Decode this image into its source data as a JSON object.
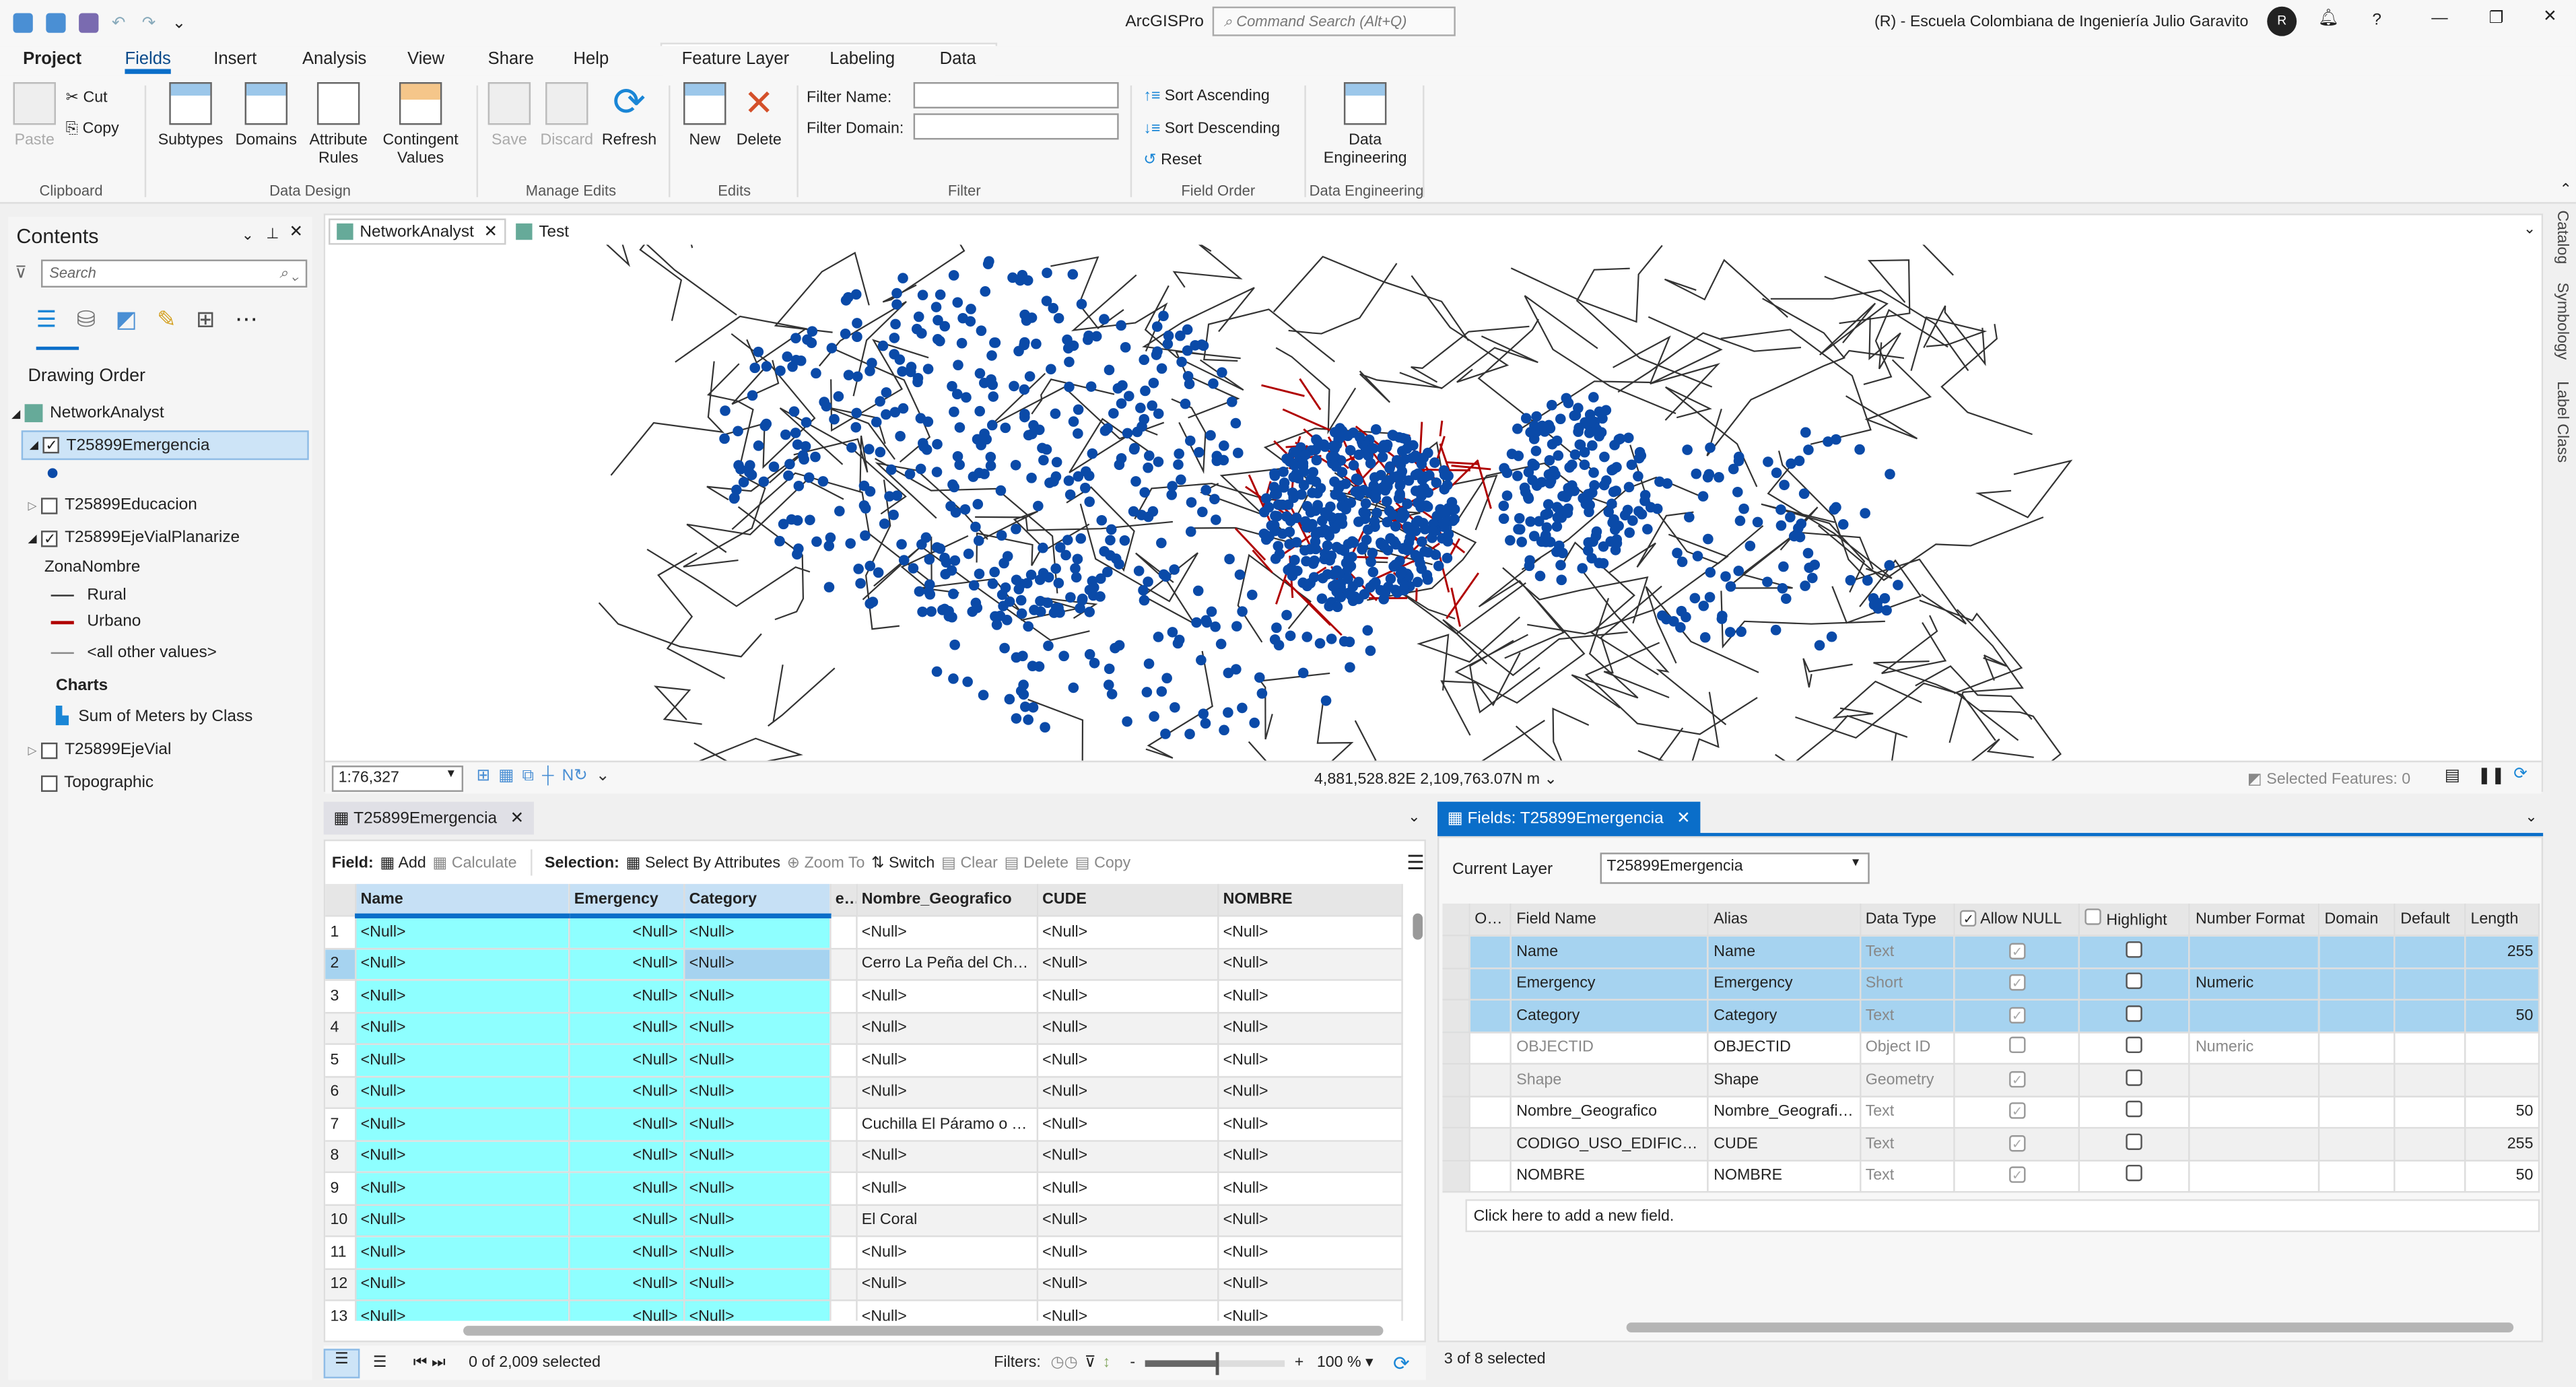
{
  "app": {
    "title": "ArcGISPro",
    "search_placeholder": "Command Search (Alt+Q)",
    "account": "(R) - Escuela Colombiana de Ingeniería Julio Garavito",
    "avatar": "R"
  },
  "tabs": [
    "Project",
    "Fields",
    "Insert",
    "Analysis",
    "View",
    "Share",
    "Help"
  ],
  "context_tabs": [
    "Feature Layer",
    "Labeling",
    "Data"
  ],
  "ribbon": {
    "clipboard": {
      "paste": "Paste",
      "cut": "Cut",
      "copy": "Copy",
      "group": "Clipboard"
    },
    "data_design": {
      "subtypes": "Subtypes",
      "domains": "Domains",
      "attribute_rules": "Attribute Rules",
      "contingent_values": "Contingent Values",
      "group": "Data Design"
    },
    "manage_edits": {
      "save": "Save",
      "discard": "Discard",
      "refresh": "Refresh",
      "group": "Manage Edits"
    },
    "edits": {
      "new": "New",
      "delete": "Delete",
      "group": "Edits"
    },
    "filter": {
      "name_label": "Filter Name:",
      "domain_label": "Filter Domain:",
      "name_value": "",
      "domain_value": "",
      "group": "Filter"
    },
    "field_order": {
      "asc": "Sort Ascending",
      "desc": "Sort Descending",
      "reset": "Reset",
      "group": "Field Order"
    },
    "data_engineering": {
      "button": "Data Engineering",
      "group": "Data Engineering"
    }
  },
  "contents": {
    "title": "Contents",
    "search_placeholder": "Search",
    "drawing_order": "Drawing Order",
    "items": {
      "map": "NetworkAnalyst",
      "l1": "T25899Emergencia",
      "l2": "T25899Educacion",
      "l3": "T25899EjeVialPlanarize",
      "field": "ZonaNombre",
      "rural": "Rural",
      "urbano": "Urbano",
      "other": "<all other values>",
      "charts": "Charts",
      "chart1": "Sum of Meters by Class",
      "l4": "T25899EjeVial",
      "l5": "Topographic"
    }
  },
  "map_tabs": [
    "NetworkAnalyst",
    "Test"
  ],
  "map_status": {
    "scale": "1:76,327",
    "coords": "4,881,528.82E 2,109,763.07N m",
    "selected": "Selected Features: 0"
  },
  "right_strip": [
    "Catalog",
    "Symbology",
    "Label Class"
  ],
  "attr_table": {
    "tab": "T25899Emergencia",
    "field_label": "Field:",
    "add": "Add",
    "calculate": "Calculate",
    "selection_label": "Selection:",
    "select_by_attr": "Select By Attributes",
    "zoom_to": "Zoom To",
    "switch": "Switch",
    "clear": "Clear",
    "delete": "Delete",
    "copy": "Copy",
    "columns": [
      "Name",
      "Emergency",
      "Category",
      "e *",
      "Nombre_Geografico",
      "CUDE",
      "NOMBRE"
    ],
    "rows": [
      [
        "1",
        "<Null>",
        "<Null>",
        "<Null>",
        "",
        "<Null>",
        "<Null>",
        "<Null>"
      ],
      [
        "2",
        "<Null>",
        "<Null>",
        "<Null>",
        "",
        "Cerro La Peña del Chulo",
        "<Null>",
        "<Null>"
      ],
      [
        "3",
        "<Null>",
        "<Null>",
        "<Null>",
        "",
        "<Null>",
        "<Null>",
        "<Null>"
      ],
      [
        "4",
        "<Null>",
        "<Null>",
        "<Null>",
        "",
        "<Null>",
        "<Null>",
        "<Null>"
      ],
      [
        "5",
        "<Null>",
        "<Null>",
        "<Null>",
        "",
        "<Null>",
        "<Null>",
        "<Null>"
      ],
      [
        "6",
        "<Null>",
        "<Null>",
        "<Null>",
        "",
        "<Null>",
        "<Null>",
        "<Null>"
      ],
      [
        "7",
        "<Null>",
        "<Null>",
        "<Null>",
        "",
        "Cuchilla El Páramo o Tor...",
        "<Null>",
        "<Null>"
      ],
      [
        "8",
        "<Null>",
        "<Null>",
        "<Null>",
        "",
        "<Null>",
        "<Null>",
        "<Null>"
      ],
      [
        "9",
        "<Null>",
        "<Null>",
        "<Null>",
        "",
        "<Null>",
        "<Null>",
        "<Null>"
      ],
      [
        "10",
        "<Null>",
        "<Null>",
        "<Null>",
        "",
        "El Coral",
        "<Null>",
        "<Null>"
      ],
      [
        "11",
        "<Null>",
        "<Null>",
        "<Null>",
        "",
        "<Null>",
        "<Null>",
        "<Null>"
      ],
      [
        "12",
        "<Null>",
        "<Null>",
        "<Null>",
        "",
        "<Null>",
        "<Null>",
        "<Null>"
      ],
      [
        "13",
        "<Null>",
        "<Null>",
        "<Null>",
        "",
        "<Null>",
        "<Null>",
        "<Null>"
      ]
    ],
    "selected_count": "0 of 2,009 selected",
    "filters": "Filters:",
    "zoom": "100 %"
  },
  "fields_view": {
    "tab": "Fields: T25899Emergencia",
    "current_layer_label": "Current Layer",
    "current_layer": "T25899Emergencia",
    "columns": [
      "Only",
      "Field Name",
      "Alias",
      "Data Type",
      "Allow NULL",
      "Highlight",
      "Number Format",
      "Domain",
      "Default",
      "Length"
    ],
    "rows": [
      {
        "name": "Name",
        "alias": "Name",
        "type": "Text",
        "allow_null": true,
        "highlight": false,
        "format": "",
        "length": "255",
        "selected": true
      },
      {
        "name": "Emergency",
        "alias": "Emergency",
        "type": "Short",
        "allow_null": true,
        "highlight": false,
        "format": "Numeric",
        "length": "",
        "selected": true
      },
      {
        "name": "Category",
        "alias": "Category",
        "type": "Text",
        "allow_null": true,
        "highlight": false,
        "format": "",
        "length": "50",
        "selected": true
      },
      {
        "name": "OBJECTID",
        "alias": "OBJECTID",
        "type": "Object ID",
        "allow_null": false,
        "highlight": false,
        "format": "Numeric",
        "length": "",
        "selected": false
      },
      {
        "name": "Shape",
        "alias": "Shape",
        "type": "Geometry",
        "allow_null": true,
        "highlight": false,
        "format": "",
        "length": "",
        "selected": false
      },
      {
        "name": "Nombre_Geografico",
        "alias": "Nombre_Geografico",
        "type": "Text",
        "allow_null": true,
        "highlight": false,
        "format": "",
        "length": "50",
        "selected": false
      },
      {
        "name": "CODIGO_USO_EDIFICACION",
        "alias": "CUDE",
        "type": "Text",
        "allow_null": true,
        "highlight": false,
        "format": "",
        "length": "255",
        "selected": false
      },
      {
        "name": "NOMBRE",
        "alias": "NOMBRE",
        "type": "Text",
        "allow_null": true,
        "highlight": false,
        "format": "",
        "length": "50",
        "selected": false
      }
    ],
    "add_field": "Click here to add a new field.",
    "status": "3 of 8 selected"
  },
  "colors": {
    "accent": "#0a6ec9",
    "points": "#0a4aa8",
    "urban": "#b00000",
    "rural": "#333333",
    "cyan": "#8effff",
    "selected": "#a6d3f0"
  }
}
